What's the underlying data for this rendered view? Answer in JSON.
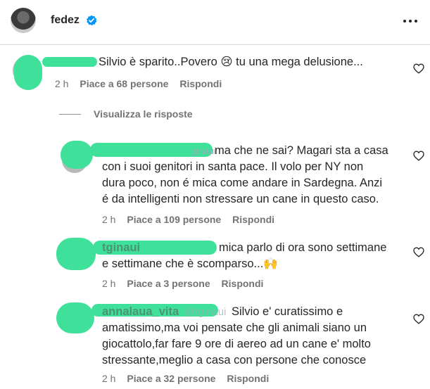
{
  "post": {
    "username": "fedez",
    "more_label": "•••"
  },
  "comments": [
    {
      "text_lines": [
        "Silvio è sparito..Povero 😢 tu una mega delusione..."
      ],
      "time": "2 h",
      "likes": "Piace a 68 persone",
      "reply": "Rispondi"
    },
    {
      "mention": "ginaui",
      "text_lines": [
        "ma che ne sai? Magari sta a casa",
        "con i suoi genitori in santa pace. Il volo per NY non",
        "dura poco, non é mica come andare in Sardegna. Anzi",
        "é da intelligenti non stressare un cane in questo caso."
      ],
      "time": "2 h",
      "likes": "Piace a 109 persone",
      "reply": "Rispondi"
    },
    {
      "username": "tginaui",
      "text_lines": [
        "mica parlo di ora sono settimane",
        "e settimane che è scomparso...🙌"
      ],
      "time": "2 h",
      "likes": "Piace a 3 persone",
      "reply": "Rispondi"
    },
    {
      "username": "annalaua_vita",
      "mention": "@tginaui",
      "text_lines": [
        "Silvio e' curatissimo e",
        "amatissimo,ma voi pensate che gli animali siano un",
        "giocattolo,far fare 9 ore di aereo ad un cane e' molto",
        "stressante,meglio a casa con persone che conosce"
      ],
      "time": "2 h",
      "likes": "Piace a 32 persone",
      "reply": "Rispondi"
    }
  ],
  "view_replies": "Visualizza le risposte",
  "colors": {
    "scribble": "#3fe09a",
    "verified": "#0095f6",
    "meta": "#737373"
  }
}
